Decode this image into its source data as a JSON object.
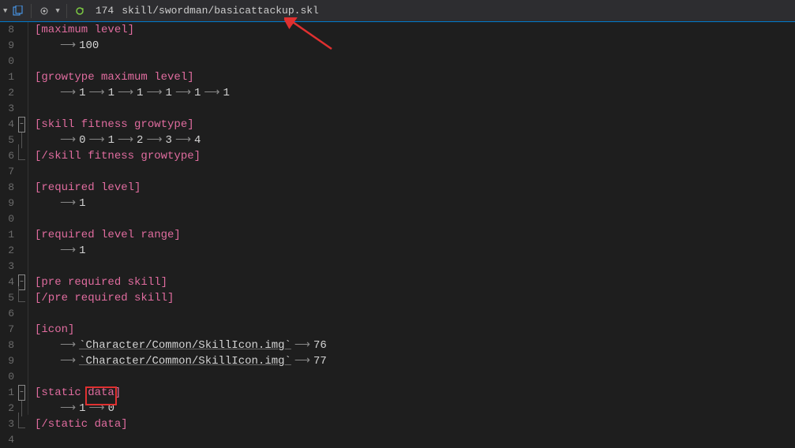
{
  "toolbar": {
    "line_number": "174",
    "filepath": "skill/swordman/basicattackup.skl"
  },
  "gutter_digits": [
    "8",
    "9",
    "0",
    "1",
    "2",
    "3",
    "4",
    "5",
    "6",
    "7",
    "8",
    "9",
    "0",
    "1",
    "2",
    "3",
    "4",
    "5",
    "6",
    "7",
    "8",
    "9",
    "0",
    "1",
    "2",
    "3",
    "4"
  ],
  "tags": {
    "max_level": "[maximum level]",
    "growtype_max": "[growtype maximum level]",
    "skill_fit_open": "[skill fitness growtype]",
    "skill_fit_close": "[/skill fitness growtype]",
    "req_level": "[required level]",
    "req_range": "[required level range]",
    "pre_req_open": "[pre required skill]",
    "pre_req_close": "[/pre required skill]",
    "icon": "[icon]",
    "static_open": "[static data]",
    "static_close": "[/static data]"
  },
  "values": {
    "max_level": "100",
    "growtype_max": [
      "1",
      "1",
      "1",
      "1",
      "1",
      "1"
    ],
    "skill_fit": [
      "0",
      "1",
      "2",
      "3",
      "4"
    ],
    "req_level": "1",
    "req_range": "1",
    "icon_path1": "`Character/Common/SkillIcon.img`",
    "icon_v1": "76",
    "icon_path2": "`Character/Common/SkillIcon.img`",
    "icon_v2": "77",
    "static": [
      "1",
      "0"
    ]
  }
}
